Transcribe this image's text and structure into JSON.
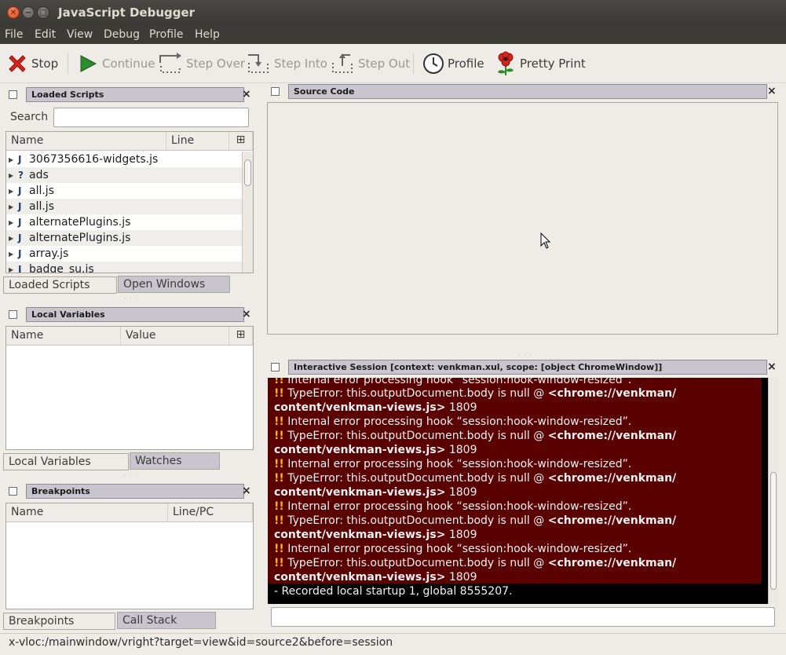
{
  "window": {
    "title": "JavaScript Debugger",
    "close_glyph": "✕",
    "min_glyph": "−",
    "max_glyph": "□"
  },
  "menu": {
    "items": [
      {
        "label": "File"
      },
      {
        "label": "Edit"
      },
      {
        "label": "View"
      },
      {
        "label": "Debug"
      },
      {
        "label": "Profile"
      },
      {
        "label": "Help"
      }
    ]
  },
  "toolbar": {
    "stop": "Stop",
    "continue": "Continue",
    "step_over": "Step Over",
    "step_into": "Step Into",
    "step_out": "Step Out",
    "profile": "Profile",
    "pretty_print": "Pretty Print"
  },
  "loaded_scripts": {
    "title": "Loaded Scripts",
    "search_label": "Search",
    "search_value": "",
    "columns": {
      "name": "Name",
      "line": "Line"
    },
    "rows": [
      {
        "type": "J",
        "name": "3067356616-widgets.js"
      },
      {
        "type": "?",
        "name": "ads"
      },
      {
        "type": "J",
        "name": "all.js"
      },
      {
        "type": "J",
        "name": "all.js"
      },
      {
        "type": "J",
        "name": "alternatePlugins.js"
      },
      {
        "type": "J",
        "name": "alternatePlugins.js"
      },
      {
        "type": "J",
        "name": "array.js"
      },
      {
        "type": "J",
        "name": "badge_su.js"
      }
    ],
    "tabs": {
      "a": "Loaded Scripts",
      "b": "Open Windows"
    }
  },
  "local_variables": {
    "title": "Local Variables",
    "columns": {
      "name": "Name",
      "value": "Value"
    },
    "tabs": {
      "a": "Local Variables",
      "b": "Watches"
    }
  },
  "breakpoints": {
    "title": "Breakpoints",
    "columns": {
      "name": "Name",
      "line": "Line/PC"
    },
    "tabs": {
      "a": "Breakpoints",
      "b": "Call Stack"
    }
  },
  "source_code": {
    "title": "Source Code"
  },
  "interactive_session": {
    "title": "Interactive Session [context: venkman.xul, scope: [object ChromeWindow]]",
    "top_partial": "Internal error processing hook “session:hook-window-resized”.",
    "error_line": "Internal error processing hook “session:hook-window-resized”.",
    "type_error": "TypeError: this.outputDocument.body is null @ ",
    "url_a": "<chrome://venkman/",
    "url_b": "content/venkman-views.js>",
    "line_no": " 1809",
    "bang": "!!",
    "dash": "-",
    "last_line": "Recorded local startup 1, global 8555207.",
    "input_value": ""
  },
  "status": {
    "url": "x-vloc:/mainwindow/vright?target=view&id=source2&before=session"
  },
  "icons": {
    "panel_close": "×",
    "expand": "▶",
    "column_picker": "⊞"
  }
}
